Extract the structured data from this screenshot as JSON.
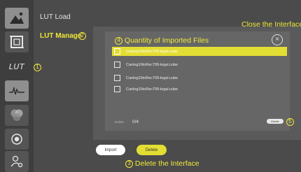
{
  "sidebar": {
    "lut_label": "LUT",
    "icons": [
      "image-mountain-icon",
      "frame-crop-icon",
      "lut-icon",
      "waveform-icon",
      "color-circles-icon",
      "record-icon",
      "user-settings-icon"
    ]
  },
  "menu": {
    "items": [
      {
        "label": "LUT Load"
      },
      {
        "label": "LUT Manage"
      }
    ]
  },
  "annotations": {
    "one": "1",
    "two": "2",
    "three": "3",
    "four": "4",
    "five": "5",
    "close_interface": "Close the Interface",
    "delete_interface": "Delete the Interface"
  },
  "dialog": {
    "title": "Quantity of Imported Files",
    "close_glyph": "×",
    "files": [
      {
        "name": "Canlog10toRec709-legal.cube",
        "selected": true
      },
      {
        "name": "Canlog10toRec709-legal.cube",
        "selected": false
      },
      {
        "name": "Canlog10toRec709-legal.cube",
        "selected": false
      },
      {
        "name": "Canlog10toRec709-legal.cube",
        "selected": false
      }
    ],
    "footer_label": "Delete",
    "count": "0/4",
    "small_delete_label": "Delete"
  },
  "buttons": {
    "import": "Import",
    "delete": "Delete"
  },
  "colors": {
    "accent": "#f0e93a",
    "panel": "#666666",
    "background": "#4b4b4b"
  }
}
